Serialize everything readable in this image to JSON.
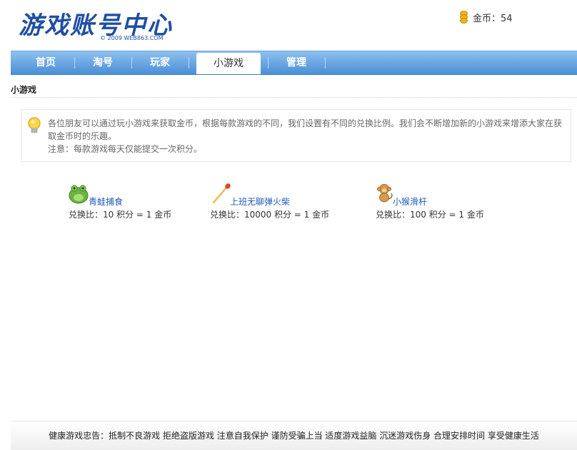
{
  "header": {
    "logo_title": "游戏账号中心",
    "logo_copyright": "© 2009 WEB863.COM",
    "coins_label": "金币：54"
  },
  "nav": {
    "tabs": [
      {
        "label": "首页"
      },
      {
        "label": "淘号"
      },
      {
        "label": "玩家"
      },
      {
        "label": "小游戏"
      },
      {
        "label": "管理"
      }
    ]
  },
  "section": {
    "title": "小游戏"
  },
  "notice": {
    "line1": "各位朋友可以通过玩小游戏来获取金币，根据每款游戏的不同，我们设置有不同的兑换比例。我们会不断增加新的小游戏来增添大家在获取金币时的乐趣。",
    "line2": "注意：每款游戏每天仅能提交一次积分。"
  },
  "games": [
    {
      "name": "青蛙捕食",
      "ratio": "兑换比：10 积分 = 1 金币",
      "icon": "frog-icon"
    },
    {
      "name": "上班无聊弹火柴",
      "ratio": "兑换比：10000 积分 = 1 金币",
      "icon": "matchstick-icon"
    },
    {
      "name": "小猴滑杆",
      "ratio": "兑换比：100 积分 = 1 金币",
      "icon": "monkey-icon"
    }
  ],
  "footer": {
    "text": "健康游戏忠告：抵制不良游戏 拒绝盗版游戏 注意自我保护 谨防受骗上当 适度游戏益脑 沉迷游戏伤身 合理安排时间 享受健康生活"
  }
}
